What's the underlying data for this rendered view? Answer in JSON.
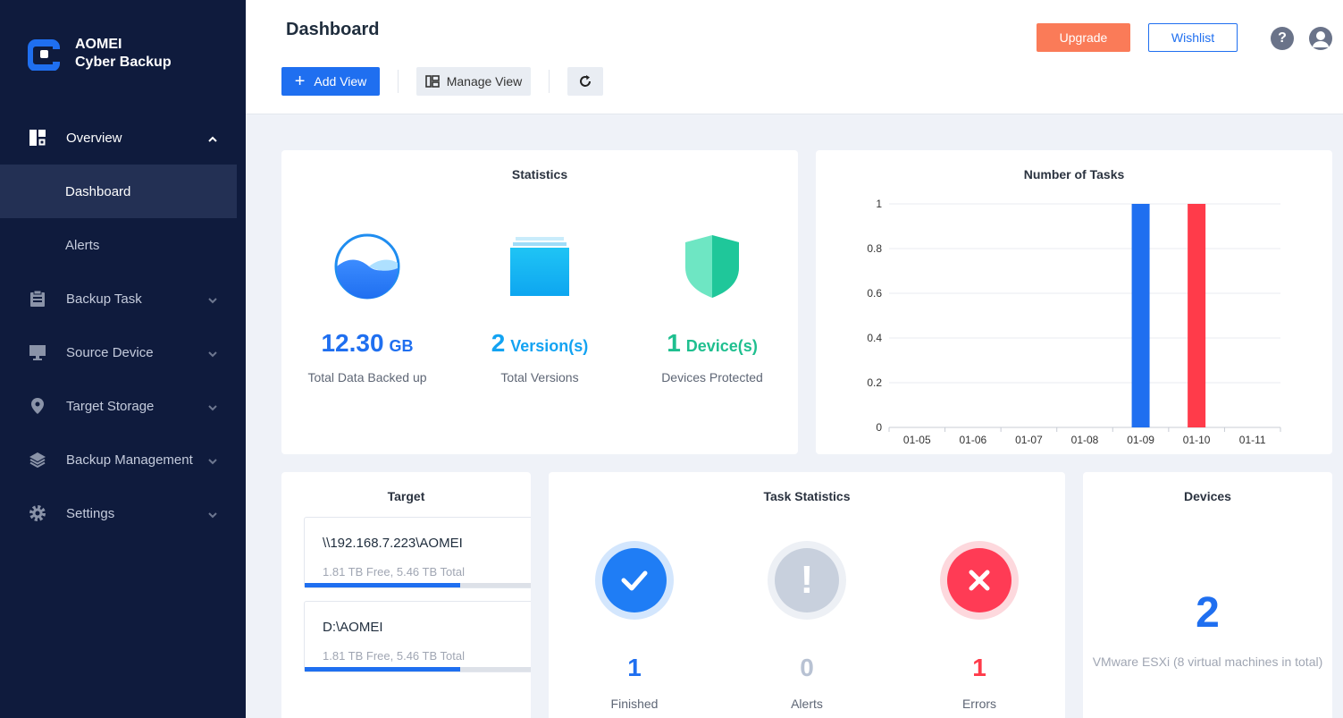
{
  "brand": {
    "line1": "AOMEI",
    "line2": "Cyber Backup"
  },
  "sidebar": {
    "items": [
      {
        "label": "Overview",
        "icon": "dashboard-layout-icon",
        "expanded": true,
        "children": [
          {
            "label": "Dashboard",
            "active": true
          },
          {
            "label": "Alerts"
          }
        ]
      },
      {
        "label": "Backup Task",
        "icon": "clipboard-icon"
      },
      {
        "label": "Source Device",
        "icon": "monitor-icon"
      },
      {
        "label": "Target Storage",
        "icon": "location-pin-icon"
      },
      {
        "label": "Backup Management",
        "icon": "layers-icon"
      },
      {
        "label": "Settings",
        "icon": "gear-icon"
      }
    ]
  },
  "header": {
    "title": "Dashboard",
    "add_view": "Add View",
    "manage_view": "Manage View",
    "upgrade": "Upgrade",
    "wishlist": "Wishlist",
    "help_symbol": "?"
  },
  "statistics": {
    "title": "Statistics",
    "items": [
      {
        "value": "12.30",
        "unit": "GB",
        "label": "Total Data Backed up",
        "color": "#1f6ff0"
      },
      {
        "value": "2",
        "unit": "Version(s)",
        "label": "Total Versions",
        "color": "#13a3f2"
      },
      {
        "value": "1",
        "unit": "Device(s)",
        "label": "Devices Protected",
        "color": "#1fbf8f"
      }
    ]
  },
  "chart_data": {
    "type": "bar",
    "title": "Number of Tasks",
    "categories": [
      "01-05",
      "01-06",
      "01-07",
      "01-08",
      "01-09",
      "01-10",
      "01-11"
    ],
    "series": [
      {
        "values": [
          0,
          0,
          0,
          0,
          1,
          0,
          0
        ],
        "color": "#1f6ff0"
      },
      {
        "values": [
          0,
          0,
          0,
          0,
          0,
          1,
          0
        ],
        "color": "#ff3b4a"
      }
    ],
    "yticks": [
      "0",
      "0.2",
      "0.4",
      "0.6",
      "0.8",
      "1"
    ],
    "ylim": [
      0,
      1
    ],
    "grid": true
  },
  "target": {
    "title": "Target",
    "items": [
      {
        "name": "\\\\192.168.7.223\\AOMEI",
        "free": "1.81 TB Free, 5.46 TB Total",
        "used_fraction": 0.668
      },
      {
        "name": "D:\\AOMEI",
        "free": "1.81 TB Free, 5.46 TB Total",
        "used_fraction": 0.668
      }
    ]
  },
  "task_statistics": {
    "title": "Task Statistics",
    "items": [
      {
        "value": "1",
        "label": "Finished",
        "color": "#1f6ff0"
      },
      {
        "value": "0",
        "label": "Alerts",
        "color": "#b8c2d3"
      },
      {
        "value": "1",
        "label": "Errors",
        "color": "#ff3b4a"
      }
    ],
    "alert_symbol": "!"
  },
  "devices": {
    "title": "Devices",
    "count": "2",
    "description": "VMware ESXi (8 virtual machines in total)"
  }
}
